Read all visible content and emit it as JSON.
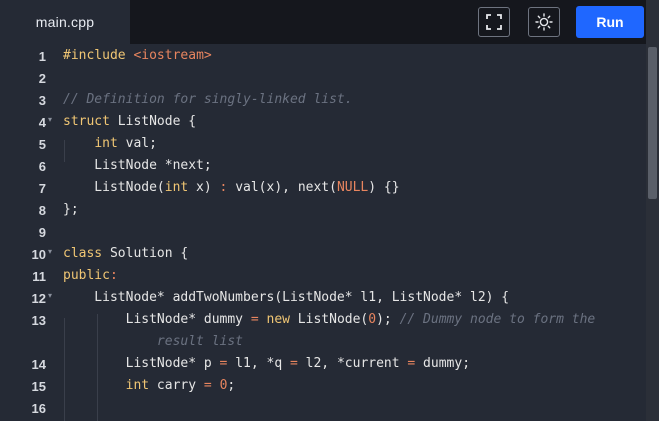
{
  "tab": {
    "filename": "main.cpp"
  },
  "toolbar": {
    "fullscreen_icon": "fullscreen-icon",
    "theme_icon": "sun-icon",
    "run_label": "Run",
    "run_color": "#1f67ff"
  },
  "editor": {
    "lines": [
      {
        "num": "1",
        "fold": "",
        "text": "#include <iostream>"
      },
      {
        "num": "2",
        "fold": "",
        "text": ""
      },
      {
        "num": "3",
        "fold": "",
        "text": "// Definition for singly-linked list."
      },
      {
        "num": "4",
        "fold": "▾",
        "text": "struct ListNode {"
      },
      {
        "num": "5",
        "fold": "",
        "text": "    int val;"
      },
      {
        "num": "6",
        "fold": "",
        "text": "    ListNode *next;"
      },
      {
        "num": "7",
        "fold": "",
        "text": "    ListNode(int x) : val(x), next(NULL) {}"
      },
      {
        "num": "8",
        "fold": "",
        "text": "};"
      },
      {
        "num": "9",
        "fold": "",
        "text": ""
      },
      {
        "num": "10",
        "fold": "▾",
        "text": "class Solution {"
      },
      {
        "num": "11",
        "fold": "",
        "text": "public:"
      },
      {
        "num": "12",
        "fold": "▾",
        "text": "    ListNode* addTwoNumbers(ListNode* l1, ListNode* l2) {"
      },
      {
        "num": "13",
        "fold": "",
        "text": "        ListNode* dummy = new ListNode(0); // Dummy node to form the"
      },
      {
        "num": "",
        "fold": "",
        "text": "            result list"
      },
      {
        "num": "14",
        "fold": "",
        "text": "        ListNode* p = l1, *q = l2, *current = dummy;"
      },
      {
        "num": "15",
        "fold": "",
        "text": "        int carry = 0;"
      },
      {
        "num": "16",
        "fold": "",
        "text": ""
      }
    ]
  }
}
